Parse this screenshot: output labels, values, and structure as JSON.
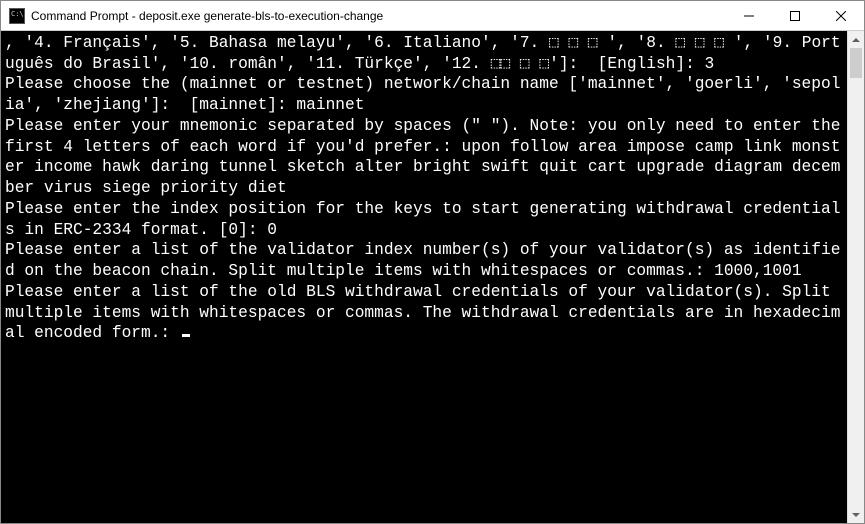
{
  "window": {
    "title": "Command Prompt - deposit.exe  generate-bls-to-execution-change"
  },
  "terminal": {
    "content": ", '4. Français', '5. Bahasa melayu', '6. Italiano', '7. ⬚ ⬚ ⬚ ', '8. ⬚ ⬚ ⬚ ', '9. Português do Brasil', '10. român', '11. Türkçe', '12. ⬚⬚ ⬚ ⬚']:  [English]: 3\nPlease choose the (mainnet or testnet) network/chain name ['mainnet', 'goerli', 'sepolia', 'zhejiang']:  [mainnet]: mainnet\nPlease enter your mnemonic separated by spaces (\" \"). Note: you only need to enter the first 4 letters of each word if you'd prefer.: upon follow area impose camp link monster income hawk daring tunnel sketch alter bright swift quit cart upgrade diagram december virus siege priority diet\nPlease enter the index position for the keys to start generating withdrawal credentials in ERC-2334 format. [0]: 0\nPlease enter a list of the validator index number(s) of your validator(s) as identified on the beacon chain. Split multiple items with whitespaces or commas.: 1000,1001\nPlease enter a list of the old BLS withdrawal credentials of your validator(s). Split multiple items with whitespaces or commas. The withdrawal credentials are in hexadecimal encoded form.: "
  }
}
